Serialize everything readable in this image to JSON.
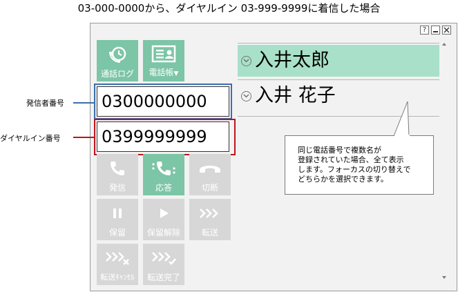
{
  "caption": "03-000-0000から、ダイヤルイン 03-999-9999に着信した場合",
  "window_controls": {
    "help": "?"
  },
  "buttons": {
    "call_log": "通話ログ",
    "phonebook": "電話帳",
    "send": "発信",
    "answer": "応答",
    "disconnect": "切断",
    "hold": "保留",
    "unhold": "保留解除",
    "transfer": "転送",
    "transfer_cancel": "転送ｷｬﾝｾﾙ",
    "transfer_complete": "転送完了"
  },
  "fields": {
    "caller_number": "0300000000",
    "dial_in_number": "0399999999"
  },
  "labels": {
    "caller_number": "発信者番号",
    "dial_in_number": "ダイヤルイン番号"
  },
  "contacts": [
    {
      "name": "入井太郎",
      "selected": true
    },
    {
      "name": "入井 花子",
      "selected": false
    }
  ],
  "callout": {
    "lines": [
      "同じ電話番号で複数名が",
      "登録されていた場合、全て表示",
      "します。フォーカスの切り替えで",
      "どちらかを選択できます。"
    ]
  },
  "colors": {
    "accent_green": "#7cc5a6",
    "selected_row": "#a9e0c9",
    "disabled_button": "#d7d7d7",
    "caller_frame": "#3a6eae",
    "dial_in_frame": "#c0121c"
  }
}
